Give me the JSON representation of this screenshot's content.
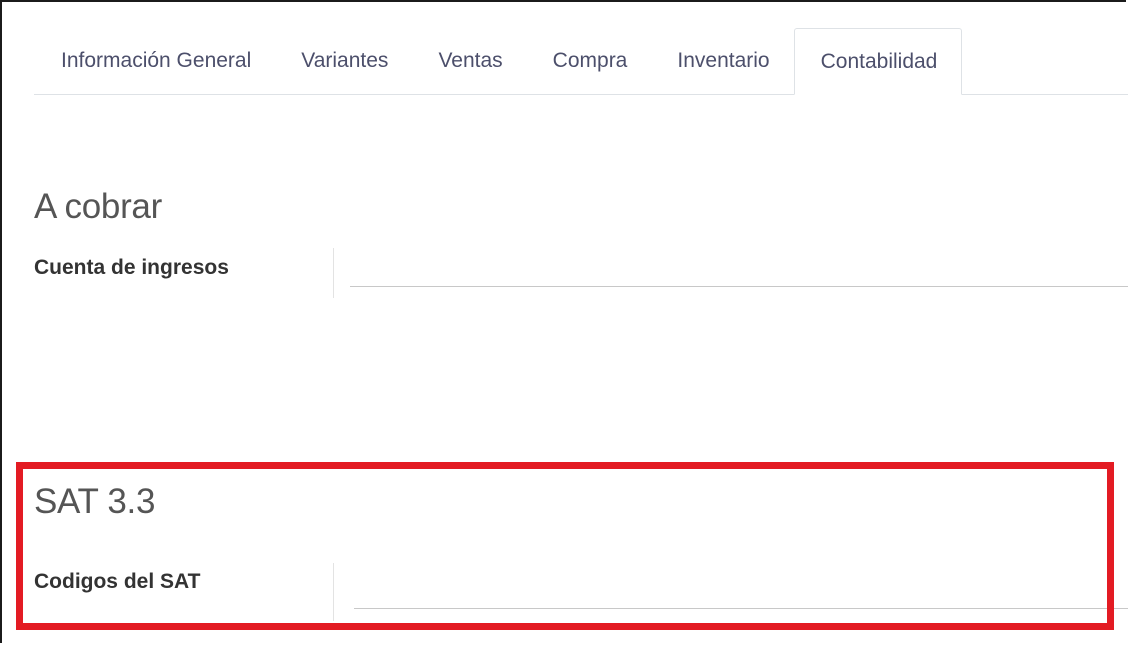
{
  "tabs": [
    {
      "label": "Información General"
    },
    {
      "label": "Variantes"
    },
    {
      "label": "Ventas"
    },
    {
      "label": "Compra"
    },
    {
      "label": "Inventario"
    },
    {
      "label": "Contabilidad"
    }
  ],
  "active_tab": "Contabilidad",
  "receivable_section": {
    "title": "A cobrar",
    "income_account_label": "Cuenta de ingresos",
    "income_account_value": ""
  },
  "sat_section": {
    "title": "SAT 3.3",
    "sat_codes_label": "Codigos del SAT",
    "sat_codes_value": ""
  },
  "colors": {
    "highlight": "#e31b23",
    "tab_text": "#4c4f6b"
  }
}
